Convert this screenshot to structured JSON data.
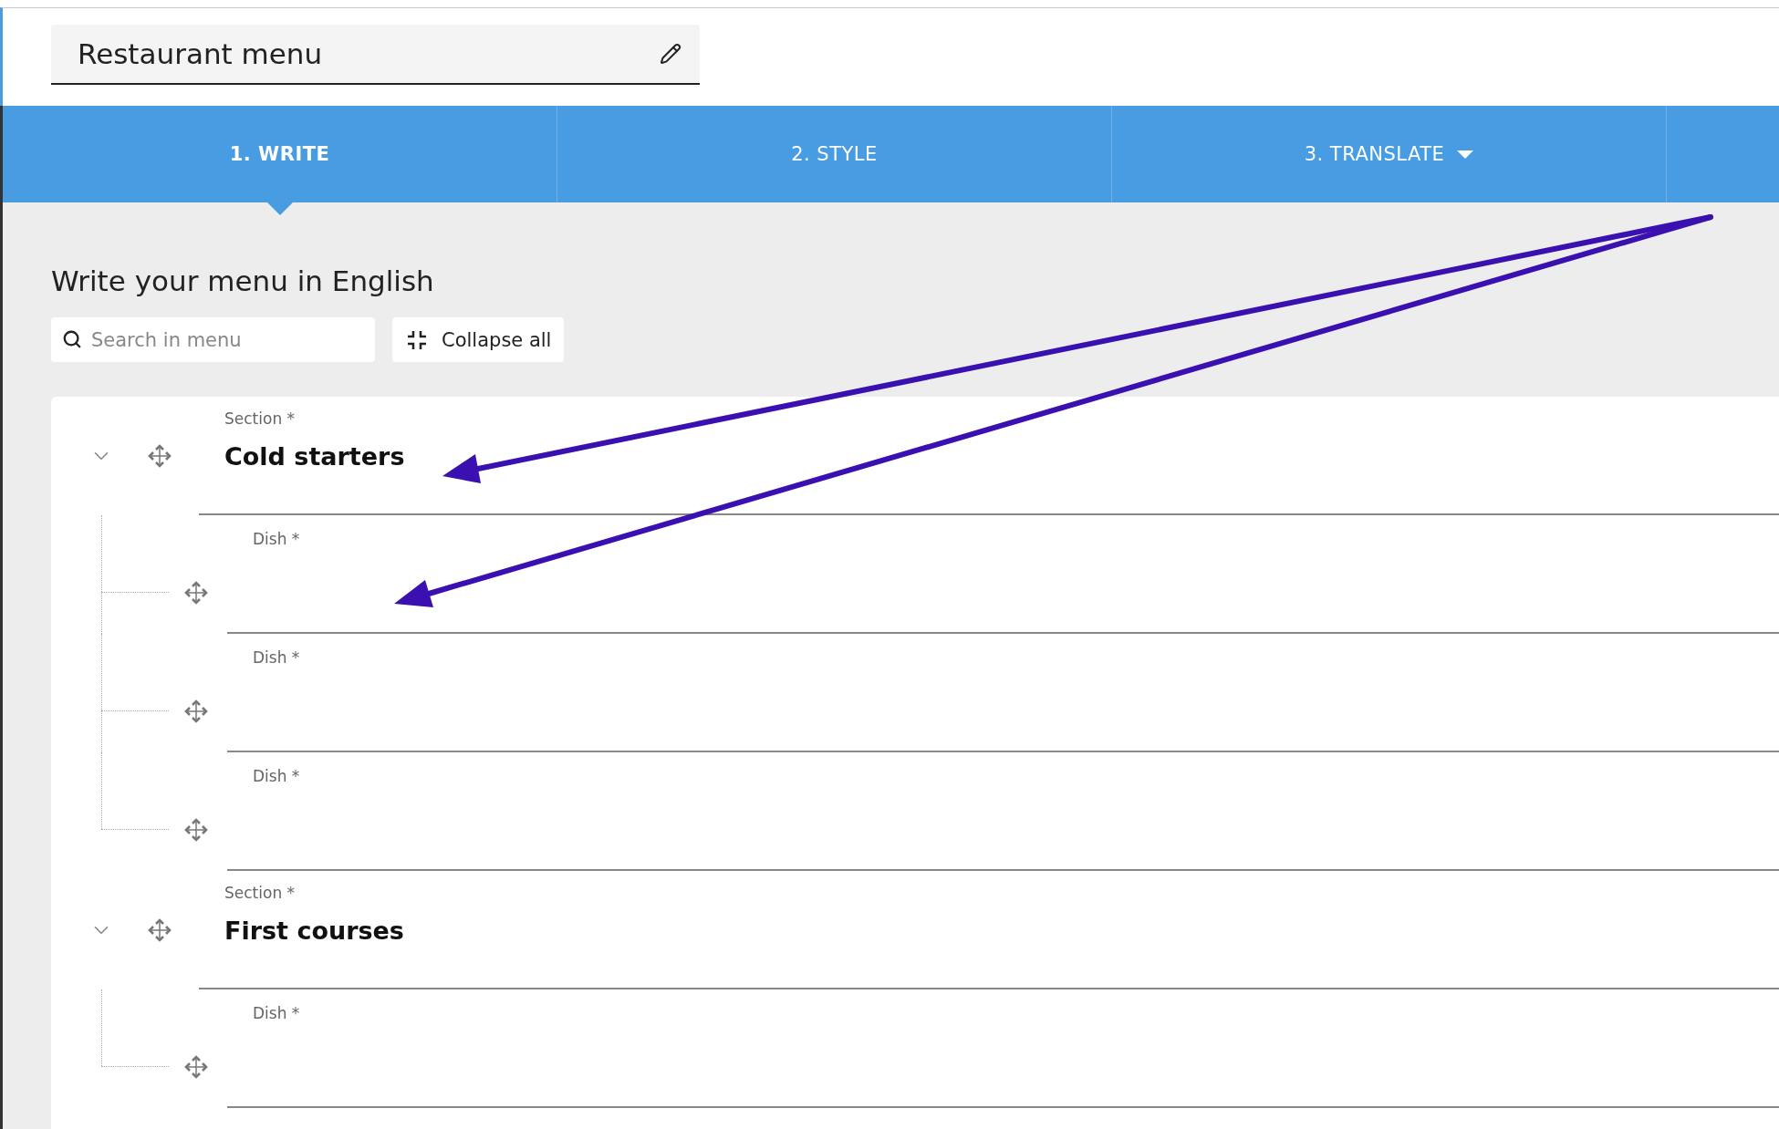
{
  "document_title": "Restaurant menu",
  "tabs": [
    {
      "label": "1. WRITE",
      "selected": true,
      "has_menu": false
    },
    {
      "label": "2. STYLE",
      "selected": false,
      "has_menu": false
    },
    {
      "label": "3. TRANSLATE",
      "selected": false,
      "has_menu": true
    }
  ],
  "heading": "Write your menu in English",
  "search": {
    "placeholder": "Search in menu"
  },
  "collapse_button": "Collapse all",
  "sections": [
    {
      "label": "Section *",
      "value": "Cold starters",
      "expanded": true,
      "dishes": [
        {
          "label": "Dish *"
        },
        {
          "label": "Dish *"
        },
        {
          "label": "Dish *"
        }
      ]
    },
    {
      "label": "Section *",
      "value": "First courses",
      "expanded": true,
      "dishes": [
        {
          "label": "Dish *"
        }
      ]
    }
  ]
}
